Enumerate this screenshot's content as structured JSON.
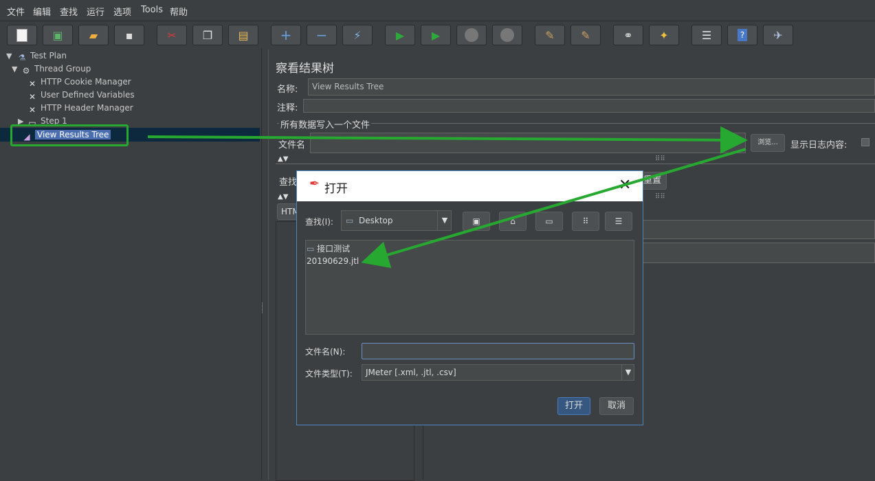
{
  "menu": [
    "文件",
    "编辑",
    "查找",
    "运行",
    "选项",
    "Tools",
    "帮助"
  ],
  "tree": {
    "items": [
      {
        "label": "Test Plan"
      },
      {
        "label": "Thread Group"
      },
      {
        "label": "HTTP Cookie Manager"
      },
      {
        "label": "User Defined Variables"
      },
      {
        "label": "HTTP Header Manager"
      },
      {
        "label": "Step 1"
      },
      {
        "label": "View Results Tree"
      }
    ]
  },
  "panel": {
    "title": "察看结果树",
    "name_label": "名称:",
    "name_value": "View Results Tree",
    "comment_label": "注释:",
    "group_title": "所有数据写入一个文件",
    "filename_label": "文件名",
    "browse_label": "浏览...",
    "log_content_label": "显示日志内容:",
    "search_label": "查找",
    "reset_label": "重置",
    "htm_tab": "HTM"
  },
  "dialog": {
    "title": "打开",
    "look_in_label": "查找(I):",
    "look_in_value": "Desktop",
    "files": [
      {
        "name": "接口测试",
        "type": "folder"
      },
      {
        "name": "20190629.jtl",
        "type": "file"
      }
    ],
    "filename_label": "文件名(N):",
    "filename_value": "",
    "filetype_label": "文件类型(T):",
    "filetype_value": "JMeter [.xml, .jtl, .csv]",
    "open_label": "打开",
    "cancel_label": "取消"
  },
  "colors": {
    "background": "#3c3f41",
    "selection": "#4b6eaf",
    "annotation_green": "#27a830",
    "dialog_border": "#4a88c7"
  }
}
